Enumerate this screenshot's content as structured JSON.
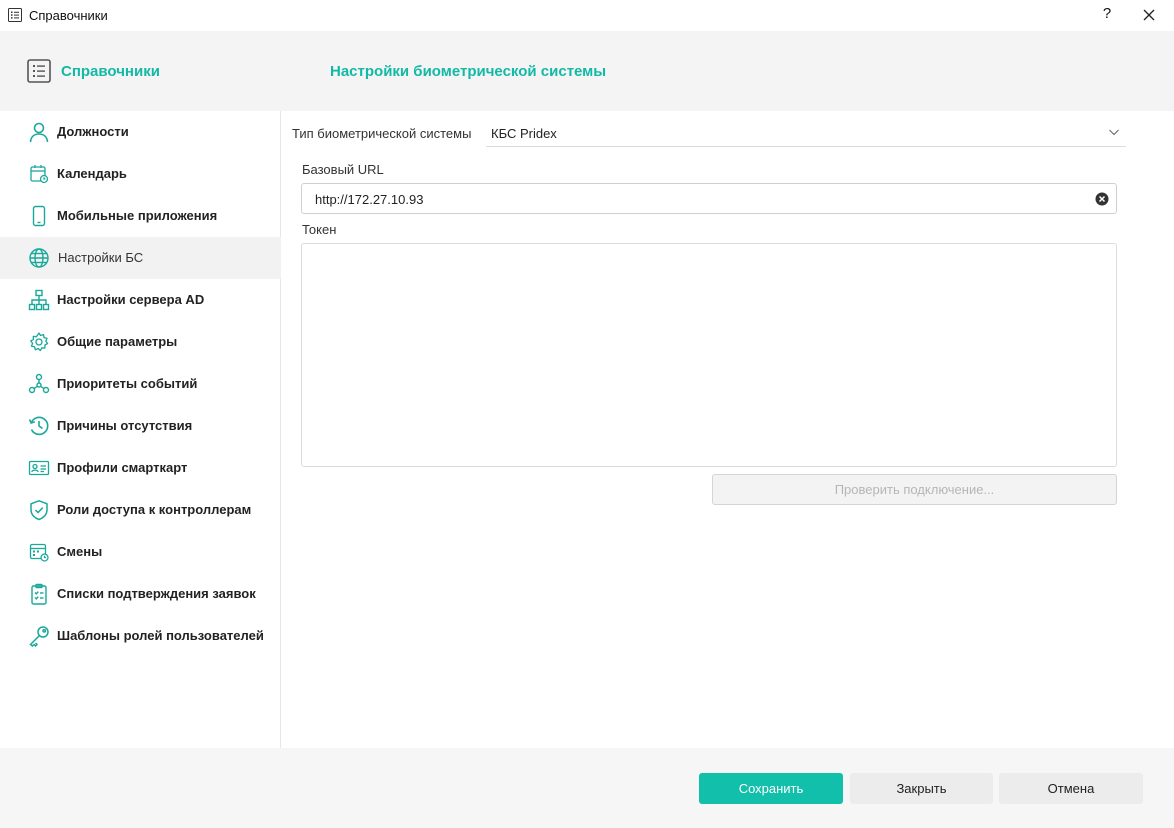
{
  "window": {
    "title": "Справочники",
    "help_label": "?"
  },
  "header": {
    "section_title": "Справочники",
    "page_title": "Настройки биометрической системы"
  },
  "sidebar": {
    "items": [
      {
        "label": "Должности",
        "icon": "person-icon"
      },
      {
        "label": "Календарь",
        "icon": "calendar-icon"
      },
      {
        "label": "Мобильные приложения",
        "icon": "mobile-phone-icon"
      },
      {
        "label": "Настройки БС",
        "icon": "globe-icon",
        "active": true
      },
      {
        "label": "Настройки сервера AD",
        "icon": "network-tree-icon"
      },
      {
        "label": "Общие параметры",
        "icon": "gear-icon"
      },
      {
        "label": "Приоритеты событий",
        "icon": "nodes-icon"
      },
      {
        "label": "Причины отсутствия",
        "icon": "clock-history-icon"
      },
      {
        "label": "Профили смарткарт",
        "icon": "id-card-icon"
      },
      {
        "label": "Роли доступа к контроллерам",
        "icon": "shield-check-icon"
      },
      {
        "label": "Смены",
        "icon": "shift-calendar-icon"
      },
      {
        "label": "Списки подтверждения заявок",
        "icon": "clipboard-check-icon"
      },
      {
        "label": "Шаблоны ролей пользователей",
        "icon": "key-icon"
      }
    ]
  },
  "form": {
    "bs_type_label": "Тип биометрической системы",
    "bs_type_value": "КБС Pridex",
    "url_label": "Базовый URL",
    "url_value": "http://172.27.10.93",
    "token_label": "Токен",
    "token_value": "",
    "check_button": "Проверить подключение..."
  },
  "footer": {
    "save": "Сохранить",
    "close": "Закрыть",
    "cancel": "Отмена"
  },
  "colors": {
    "accent": "#12bfaa",
    "accent_text": "#12b9a6",
    "icon": "#1aa89a"
  }
}
